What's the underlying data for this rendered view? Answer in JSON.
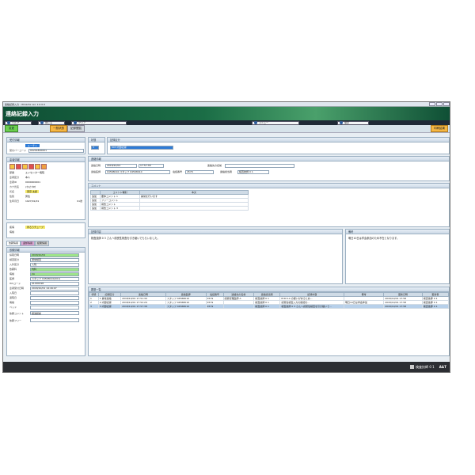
{
  "window": {
    "title": "連絡記録入力 - Winacta ver. 1.0.0.0",
    "screen_title": "連絡記録入力"
  },
  "menubar": {
    "items": [
      "ヘルプ",
      "閉じる",
      "クリア",
      "メニュー",
      "保存"
    ]
  },
  "toolbar": {
    "new_label": "変更",
    "tab1": "一般状態",
    "tab2": "記録閲覧",
    "right_button": "印刷結果"
  },
  "left": {
    "reception_header": "受付情報",
    "routine_badge": "ルーチン",
    "barcode_label": "受付バーコード",
    "barcode_value": "00201800001",
    "patient_header": "患者情報",
    "patient_rows": [
      {
        "label": "部署",
        "value": "エイセンター病院"
      },
      {
        "label": "患者区分",
        "value": "本人"
      },
      {
        "label": "患者ID",
        "value": "0000000001"
      },
      {
        "label": "カナ氏名",
        "value": "ﾄｳｷｮｳ ﾀﾛｳ"
      },
      {
        "label": "氏名",
        "value": "東京 太郎"
      },
      {
        "label": "性別",
        "value": "男性"
      },
      {
        "label": "生年月日",
        "value": "1927/01/01",
        "extra": "91歳"
      }
    ],
    "section2": [
      {
        "label": "疾病",
        "value": "胃ろうチューブ"
      },
      {
        "label": "病棟",
        "value": ""
      }
    ],
    "tabs": [
      "依頼情報",
      "返却情報",
      "結果情報"
    ],
    "order_header": "依頼情報",
    "order_rows": [
      {
        "label": "採取日時",
        "value": "2018/10/01",
        "hl": true
      },
      {
        "label": "検査区分",
        "value": "通常検査"
      },
      {
        "label": "入外区分",
        "value": "入院"
      },
      {
        "label": "依頼科",
        "value": "内科",
        "hl": true
      },
      {
        "label": "病棟",
        "value": "2A",
        "hl": true
      },
      {
        "label": "医師",
        "value": "スタッフ 04568010(001)"
      },
      {
        "label": "HISコード",
        "value": "91000196"
      },
      {
        "label": "患者受付日時",
        "value": "2018/10/01 14:49:07"
      },
      {
        "label": "入院日",
        "value": ""
      },
      {
        "label": "退院日",
        "value": ""
      },
      {
        "label": "病棟",
        "value": ""
      },
      {
        "label": "ベッド",
        "value": ""
      },
      {
        "label": "依頼コメント",
        "value": "経過観察"
      },
      {
        "label": "依頼フリー",
        "value": ""
      }
    ]
  },
  "main": {
    "state_header": "状態",
    "state_value": "3",
    "record_header": "記録区分",
    "record_value": "003 内部記録",
    "contact_header": "連絡情報",
    "contact_date_label": "連絡日時",
    "contact_date": "2018/10/01",
    "contact_time": "17:57:38",
    "contact_doctor_label": "連絡医師",
    "contact_doctor": "04568010:スタッフ 04568010",
    "phone_label": "電話番号",
    "phone": "4579",
    "recipient_label": "連絡先の名前",
    "recipient": "",
    "person_label": "連絡担当者",
    "person": "検査技師 0 1",
    "comment_header": "コメント",
    "comment_cols": [
      "",
      "コメント種別",
      "本文"
    ],
    "comments": [
      [
        "追加",
        "要体コメント 1",
        "異常を行います"
      ],
      [
        "追加",
        "フリーコメント",
        ""
      ],
      [
        "追加",
        "報告コメント",
        ""
      ],
      [
        "追加",
        "報告コメント 3",
        ""
      ]
    ],
    "record_content_header": "記録内容",
    "record_content": "検査技師 0 3 さんへ感受性検査を引き継いでもらいました。",
    "notes_header": "備考",
    "notes": "明日10日は学会参加のため不在となります。",
    "history_header": "履歴一覧",
    "history_cols": [
      "状態",
      "記録区分",
      "連絡日時",
      "連絡医師",
      "電話番号",
      "連絡先の名前",
      "連絡担当者",
      "記録内容",
      "備考",
      "更新日時",
      "更新者"
    ],
    "history_rows": [
      [
        "1",
        "1 異常連絡",
        "2018/10/01 17:51:30",
        "スタッフ 04568010",
        "4579",
        "感染管理医師 A",
        "検査技師 0 1",
        "M.R.S.A の疑いがあるため...",
        "",
        "2018/10/01 17:58",
        "検査技師 0 1"
      ],
      [
        "2",
        "2 内部記録",
        "2018/10/01 17:52:29",
        "スタッフ 04568010",
        "4579",
        "",
        "検査技師 0 1",
        "感受性検査入力の確認の...",
        "明日10日は学会参加",
        "2018/10/01 17:58",
        "検査技師 0 1"
      ],
      [
        "3",
        "3 内部記録",
        "2018/10/01 17:57:38",
        "スタッフ 04568010",
        "4579",
        "",
        "検査技師 0 1",
        "検査技師 0 3 さんへ感受性検査を引き継いで...",
        "",
        "2018/10/01 17:58",
        "検査技師 0 1"
      ]
    ]
  },
  "status": {
    "user": "検査技師 0 1",
    "brand": "A&T"
  }
}
